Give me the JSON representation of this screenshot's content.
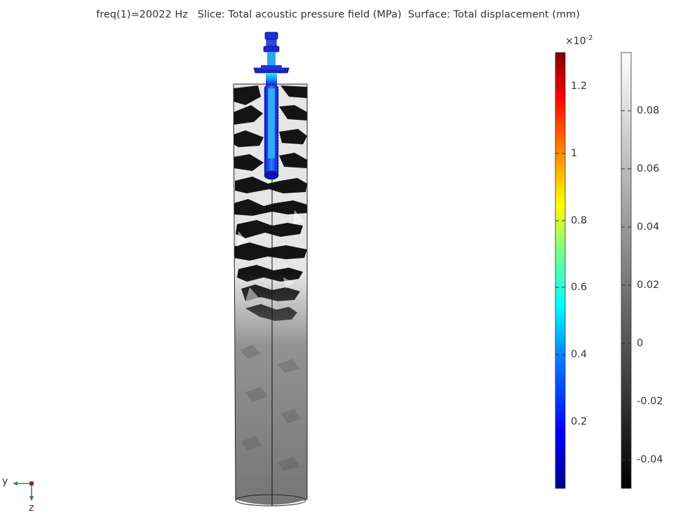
{
  "title": {
    "frequency": "freq(1)=20022 Hz",
    "slice": "Slice: Total acoustic pressure field (MPa)",
    "surface": "Surface: Total displacement (mm)"
  },
  "pressure_legend": {
    "exponent_base": "×10",
    "exponent_power": "-2",
    "ticks": [
      "1.2",
      "1",
      "0.8",
      "0.6",
      "0.4",
      "0.2"
    ],
    "colors": [
      "#00008f",
      "#0000ff",
      "#0080ff",
      "#00ffff",
      "#80ff80",
      "#ffff00",
      "#ff8000",
      "#ff0000",
      "#800000"
    ]
  },
  "displacement_legend": {
    "ticks": [
      "0.08",
      "0.06",
      "0.04",
      "0.02",
      "0",
      "-0.02",
      "-0.04"
    ],
    "colors": [
      "#000000",
      "#ffffff"
    ]
  },
  "axes": {
    "y_label": "y",
    "z_label": "z",
    "y_color": "#2a9a2a",
    "z_color": "#3366cc",
    "x_color": "#aa2222"
  }
}
